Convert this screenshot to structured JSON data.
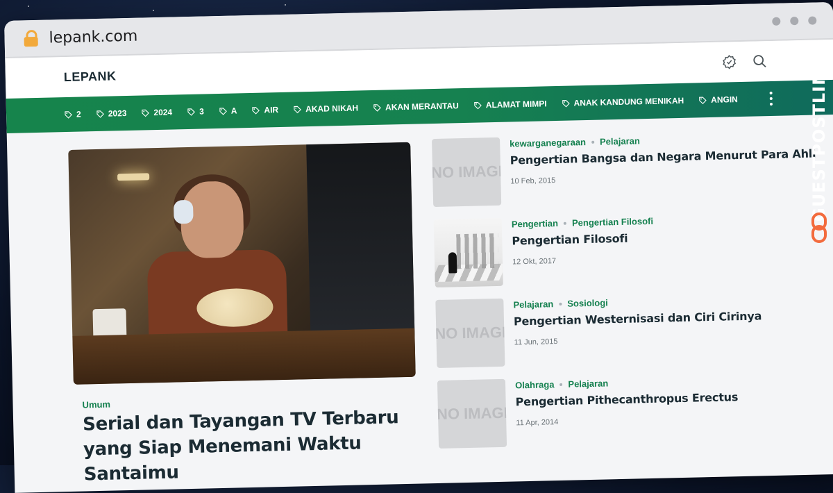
{
  "browser": {
    "url": "lepank.com"
  },
  "site": {
    "logo": "LEPANK"
  },
  "nav": {
    "items": [
      "2",
      "2023",
      "2024",
      "3",
      "A",
      "AIR",
      "AKAD NIKAH",
      "AKAN MERANTAU",
      "ALAMAT MIMPI",
      "ANAK KANDUNG MENIKAH",
      "ANGIN"
    ]
  },
  "hero": {
    "category": "Umum",
    "title": "Serial dan Tayangan TV Terbaru yang Siap Menemani Waktu Santaimu"
  },
  "posts": [
    {
      "cat1": "kewarganegaraan",
      "cat2": "Pelajaran",
      "title": "Pengertian Bangsa dan Negara Menurut Para Ahli",
      "date": "10 Feb, 2015",
      "thumb_text": "NO IMAGE"
    },
    {
      "cat1": "Pengertian",
      "cat2": "Pengertian Filosofi",
      "title": "Pengertian Filosofi",
      "date": "12 Okt, 2017",
      "thumb_text": ""
    },
    {
      "cat1": "Pelajaran",
      "cat2": "Sosiologi",
      "title": "Pengertian Westernisasi dan Ciri Cirinya",
      "date": "11 Jun, 2015",
      "thumb_text": "NO IMAGE"
    },
    {
      "cat1": "Olahraga",
      "cat2": "Pelajaran",
      "title": "Pengertian Pithecanthropus Erectus",
      "date": "11 Apr, 2014",
      "thumb_text": "NO IMAGE"
    }
  ],
  "watermark": {
    "text": "GUESTPOSTLINKS"
  },
  "colors": {
    "accent": "#168150",
    "nav_bg": "#16844c",
    "watermark": "#f36b3d"
  }
}
